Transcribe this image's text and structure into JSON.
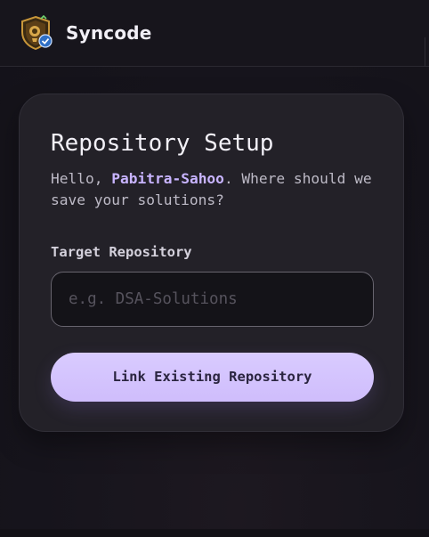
{
  "header": {
    "app_name": "Syncode"
  },
  "setup": {
    "title": "Repository Setup",
    "greeting_prefix": "Hello, ",
    "username": "Pabitra-Sahoo",
    "greeting_suffix": ". Where should we save your solutions?",
    "field_label": "Target Repository",
    "input_value": "",
    "input_placeholder": "e.g. DSA-Solutions",
    "button_label": "Link Existing Repository"
  },
  "colors": {
    "accent": "#cfbdfc",
    "username_highlight": "#c8b4ff",
    "logo_shield": "#b8862e",
    "logo_badge": "#4a8fe0"
  },
  "icons": {
    "logo": "shield-check-logo"
  }
}
